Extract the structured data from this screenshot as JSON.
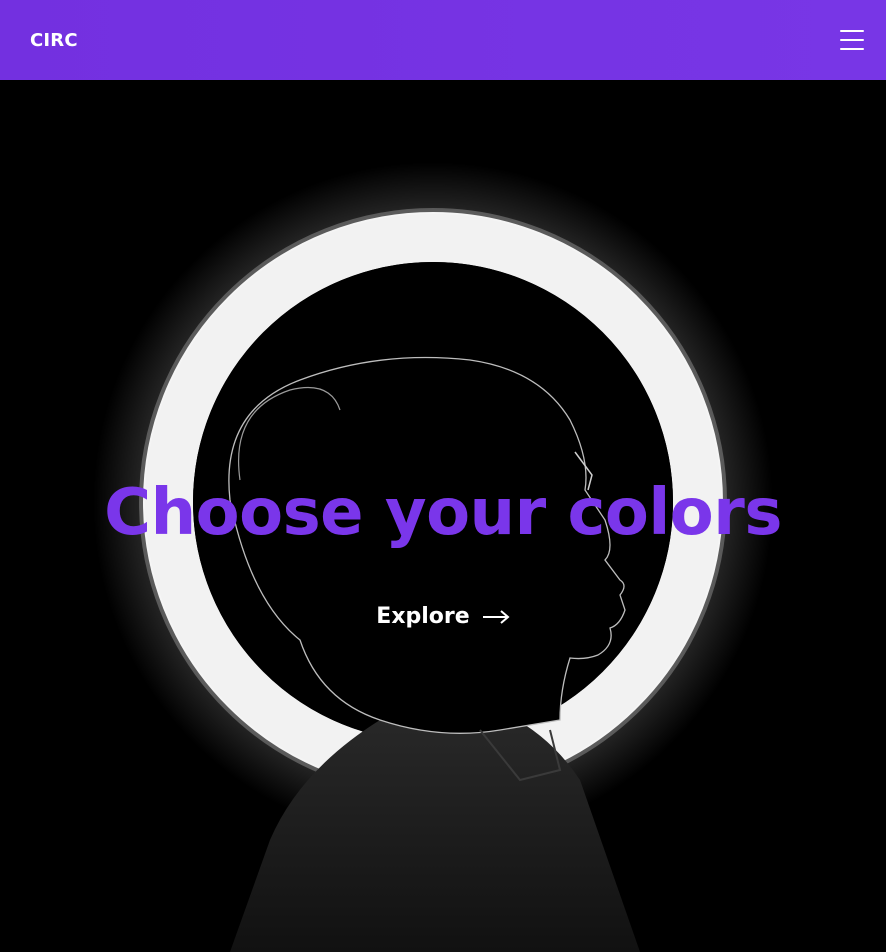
{
  "header": {
    "brand": "CIRC",
    "menu_icon": "hamburger-menu-icon"
  },
  "hero": {
    "headline": "Choose your colors",
    "cta_label": "Explore",
    "cta_icon": "arrow-right-icon",
    "image": "ring-light-silhouette-photo"
  },
  "colors": {
    "header_bg": "#7633e4",
    "headline": "#7a36ea",
    "text": "#ffffff",
    "background": "#000000"
  }
}
